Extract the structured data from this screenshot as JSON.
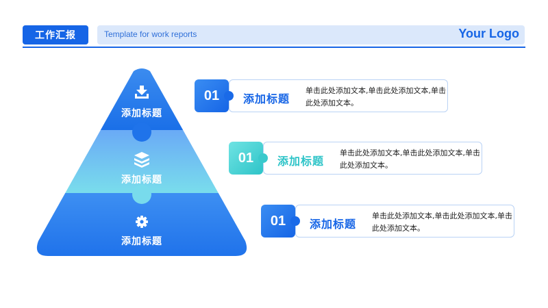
{
  "header": {
    "badge": "工作汇报",
    "subtitle": "Template for work reports",
    "logo": "Your Logo"
  },
  "pyramid": {
    "tiers": [
      {
        "label": "添加标题",
        "icon": "inbox-download-icon"
      },
      {
        "label": "添加标题",
        "icon": "layers-icon"
      },
      {
        "label": "添加标题",
        "icon": "gear-icon"
      }
    ]
  },
  "cards": [
    {
      "number": "01",
      "title": "添加标题",
      "desc": "单击此处添加文本,单击此处添加文本,单击此处添加文本。",
      "accent": "#1665e6"
    },
    {
      "number": "01",
      "title": "添加标题",
      "desc": "单击此处添加文本,单击此处添加文本,单击此处添加文本。",
      "accent": "#2ec4c8"
    },
    {
      "number": "01",
      "title": "添加标题",
      "desc": "单击此处添加文本,单击此处添加文本,单击此处添加文本。",
      "accent": "#1665e6"
    }
  ],
  "colors": {
    "primary": "#1665e6",
    "teal": "#2ec4c8",
    "light": "#dbe8fb"
  }
}
